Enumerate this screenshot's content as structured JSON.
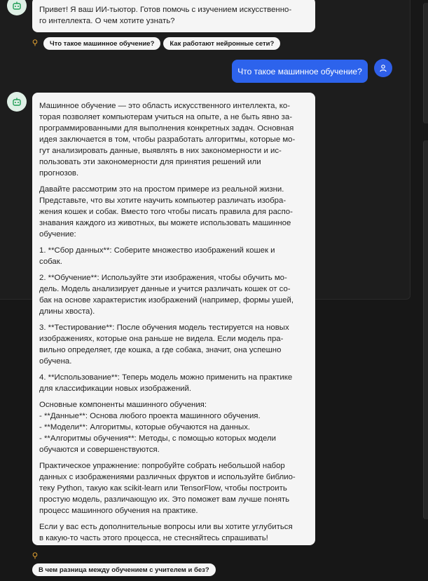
{
  "messages": {
    "greeting": "Привет! Я ваш ИИ-тьютор. Готов помочь с изучением искусственно-\nго интеллекта. О чем хотите узнать?",
    "user_question": "Что такое машинное обучение?",
    "answer": [
      "Машинное обучение — это область искусственного интеллекта, ко-\nторая позволяет компьютерам учиться на опыте, а не быть явно за-\nпрограммированными для выполнения конкретных задач. Основная\nидея заключается в том, чтобы разработать алгоритмы, которые мо-\nгут анализировать данные, выявлять в них закономерности и ис-\nпользовать эти закономерности для принятия решений или\nпрогнозов.",
      "Давайте рассмотрим это на простом примере из реальной жизни.\nПредставьте, что вы хотите научить компьютер различать изобра-\nжения кошек и собак. Вместо того чтобы писать правила для распо-\nзнавания каждого из животных, вы можете использовать машинное\nобучение:",
      "1. **Сбор данных**: Соберите множество изображений кошек и\nсобак.",
      "2. **Обучение**: Используйте эти изображения, чтобы обучить мо-\nдель. Модель анализирует данные и учится различать кошек от со-\nбак на основе характеристик изображений (например, формы ушей,\nдлины хвоста).",
      "3. **Тестирование**: После обучения модель тестируется на новых\nизображениях, которые она раньше не видела. Если модель пра-\nвильно определяет, где кошка, а где собака, значит, она успешно\nобучена.",
      "4. **Использование**: Теперь модель можно применить на практике\nдля классификации новых изображений.",
      "Основные компоненты машинного обучения:\n- **Данные**: Основа любого проекта машинного обучения.\n- **Модели**: Алгоритмы, которые обучаются на данных.\n- **Алгоритмы обучения**: Методы, с помощью которых модели\nобучаются и совершенствуются.",
      "Практическое упражнение: попробуйте собрать небольшой набор\nданных с изображениями различных фруктов и используйте библио-\nтеку Python, такую как scikit-learn или TensorFlow, чтобы построить\nпростую модель, различающую их. Это поможет вам лучше понять\nпроцесс машинного обучения на практике.",
      "Если у вас есть дополнительные вопросы или вы хотите углубиться\nв какую-то часть этого процесса, не стесняйтесь спрашивать!"
    ]
  },
  "suggestions_top": [
    "Что такое машинное обучение?",
    "Как работают нейронные сети?"
  ],
  "suggestions_bottom": [
    "В чем разница между обучением с учителем и без?"
  ],
  "icons": {
    "bot": "robot-icon",
    "user": "user-icon",
    "hint": "lightbulb-icon"
  },
  "colors": {
    "user_bubble": "#2d63ec",
    "bot_avatar_bg": "#dff0e6",
    "bot_icon": "#1f9d55",
    "hint": "#e0a030"
  }
}
